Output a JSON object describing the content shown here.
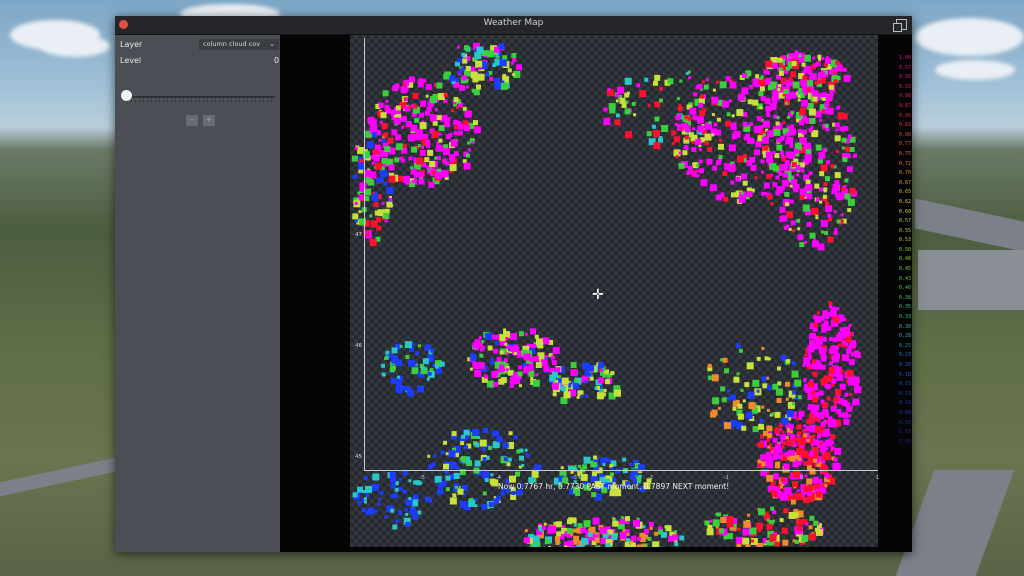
{
  "window": {
    "title": "Weather Map"
  },
  "sidebar": {
    "layer_label": "Layer",
    "layer_value": "column cloud cov",
    "level_label": "Level",
    "level_value": "0",
    "prev_button": "–",
    "next_button": "+"
  },
  "map": {
    "y_ticks": [
      "47",
      "46",
      "45"
    ],
    "x_ticks": [
      "-5",
      "-4",
      "-3",
      "-2",
      "-1",
      "0",
      "1"
    ],
    "readout": "Now 0.7767 hr, 0.7730 PAST moment, 0.7897 NEXT moment!"
  },
  "legend": {
    "values": [
      "1.00",
      "0.97",
      "0.95",
      "0.93",
      "0.90",
      "0.87",
      "0.85",
      "0.82",
      "0.80",
      "0.77",
      "0.75",
      "0.72",
      "0.70",
      "0.67",
      "0.65",
      "0.62",
      "0.60",
      "0.57",
      "0.55",
      "0.53",
      "0.50",
      "0.48",
      "0.45",
      "0.43",
      "0.40",
      "0.38",
      "0.35",
      "0.33",
      "0.30",
      "0.28",
      "0.25",
      "0.23",
      "0.20",
      "0.18",
      "0.15",
      "0.13",
      "0.10",
      "0.08",
      "0.05",
      "0.03",
      "0.00"
    ]
  },
  "colors": {
    "legend_high": "#d8148c",
    "legend_mid": "#c7d22a",
    "legend_low": "#1c2a8a",
    "cloud_magenta": "#ff00ff",
    "cloud_red": "#ff1030",
    "cloud_green": "#3ccf3c",
    "cloud_blue": "#1c3cff"
  }
}
